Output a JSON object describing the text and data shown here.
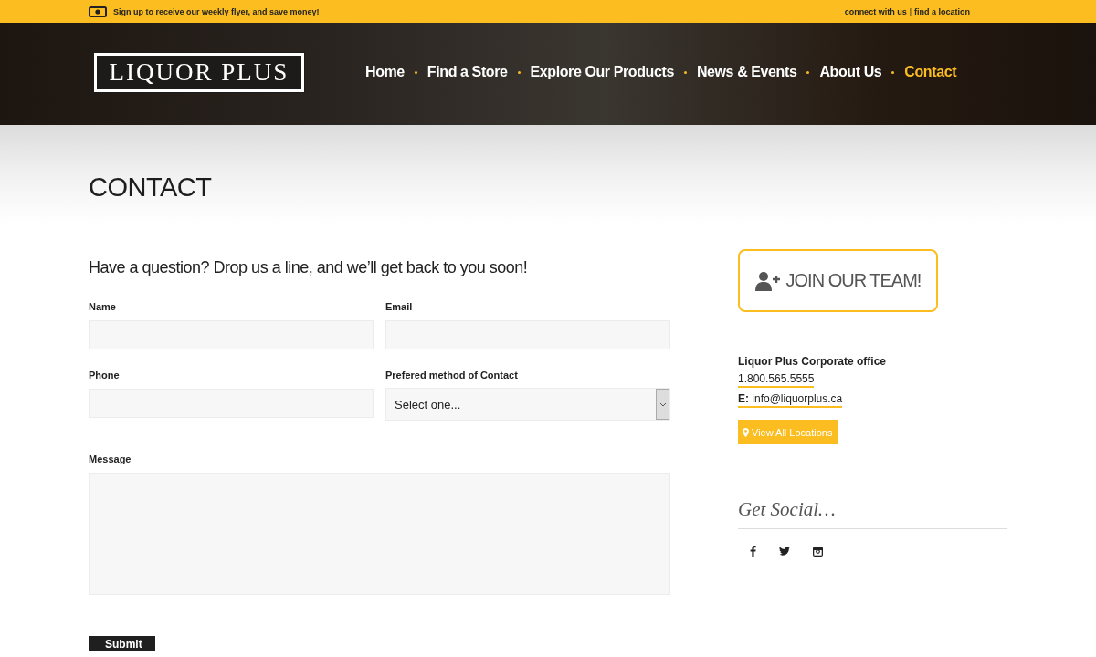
{
  "top_bar": {
    "flyer_text": "Sign up to receive our weekly flyer, and save money!",
    "links": [
      "connect with us",
      "find a location"
    ],
    "separator": "|"
  },
  "header": {
    "logo": "LIQUOR PLUS",
    "nav": [
      {
        "label": "Home",
        "selected": false
      },
      {
        "label": "Find a Store",
        "selected": false
      },
      {
        "label": "Explore Our Products",
        "selected": false
      },
      {
        "label": "News & Events",
        "selected": false
      },
      {
        "label": "About Us",
        "selected": false
      },
      {
        "label": "Contact",
        "selected": true
      }
    ]
  },
  "page_title": "CONTACT",
  "form": {
    "intro": "Have a question? Drop us a line, and we’ll get back to you soon!",
    "fields": [
      {
        "kind": "text",
        "label": "Name"
      },
      {
        "kind": "text",
        "label": "Email"
      },
      {
        "kind": "text",
        "label": "Phone"
      },
      {
        "kind": "select",
        "label": "Prefered method of Contact",
        "value": "Select one..."
      },
      {
        "kind": "textarea",
        "label": "Message"
      }
    ],
    "submit": "Submit"
  },
  "sidebar": {
    "join_button": "JOIN OUR TEAM!",
    "office": {
      "title": "Liquor Plus Corporate office",
      "phone": "1.800.565.5555",
      "email_label": "E:",
      "email": "info@liquorplus.ca"
    },
    "locations_button": "View All Locations",
    "social_heading": "Get Social…"
  }
}
